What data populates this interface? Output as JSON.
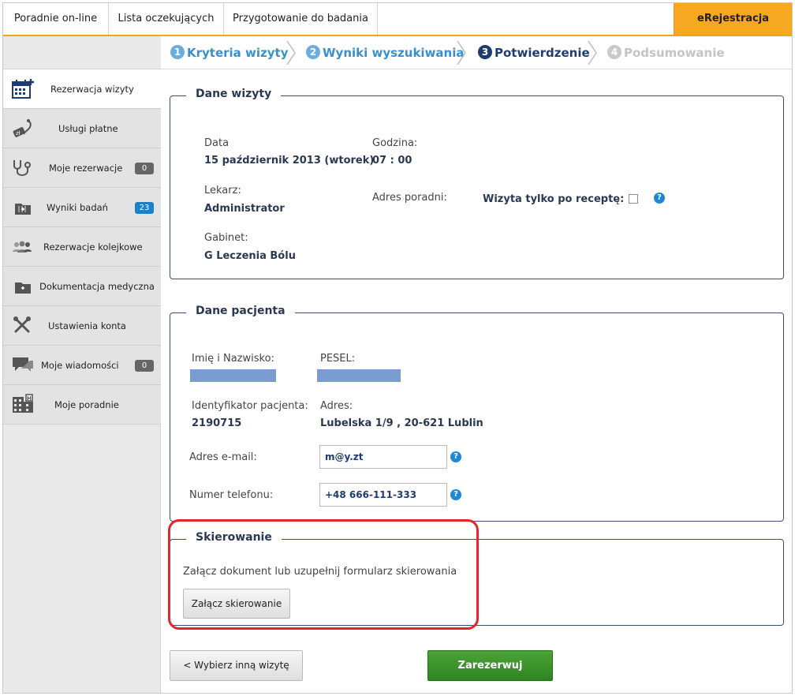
{
  "top_tabs": [
    "Poradnie on-line",
    "Lista oczekujących",
    "Przygotowanie do badania"
  ],
  "top_tab_active": "eRejestracja",
  "steps": [
    {
      "num": "1",
      "label": "Kryteria wizyty"
    },
    {
      "num": "2",
      "label": "Wyniki wyszukiwania"
    },
    {
      "num": "3",
      "label": "Potwierdzenie"
    },
    {
      "num": "4",
      "label": "Podsumowanie"
    }
  ],
  "sidebar": [
    {
      "label": "Rezerwacja wizyty",
      "icon": "calendar-icon",
      "badge": ""
    },
    {
      "label": "Usługi płatne",
      "icon": "paid-services-icon",
      "badge": ""
    },
    {
      "label": "Moje rezerwacje",
      "icon": "stethoscope-icon",
      "badge": "0"
    },
    {
      "label": "Wyniki badań",
      "icon": "folder-icon",
      "badge": "23"
    },
    {
      "label": "Rezerwacje kolejkowe",
      "icon": "people-icon",
      "badge": ""
    },
    {
      "label": "Dokumentacja medyczna",
      "icon": "folder-icon",
      "badge": ""
    },
    {
      "label": "Ustawienia konta",
      "icon": "tools-icon",
      "badge": ""
    },
    {
      "label": "Moje wiadomości",
      "icon": "chat-icon",
      "badge": "0"
    },
    {
      "label": "Moje poradnie",
      "icon": "building-icon",
      "badge": ""
    }
  ],
  "visit": {
    "legend": "Dane wizyty",
    "date_label": "Data",
    "date_value": "15 październik 2013 (wtorek)",
    "time_label": "Godzina:",
    "time_value": "07 : 00",
    "doctor_label": "Lekarz:",
    "doctor_value": "Administrator",
    "clinic_address_label": "Adres poradni:",
    "prescription_label": "Wizyta tylko po receptę:",
    "room_label": "Gabinet:",
    "room_value": "G Leczenia Bólu"
  },
  "patient": {
    "legend": "Dane pacjenta",
    "name_label": "Imię i Nazwisko:",
    "pesel_label": "PESEL:",
    "id_label": "Identyfikator pacjenta:",
    "id_value": "2190715",
    "address_label": "Adres:",
    "address_value": "Lubelska 1/9 , 20-621 Lublin",
    "email_label": "Adres e-mail:",
    "email_value": "m@y.zt",
    "phone_label": "Numer telefonu:",
    "phone_value": "+48 666-111-333"
  },
  "referral": {
    "legend": "Skierowanie",
    "text": "Załącz dokument lub uzupełnij formularz skierowania",
    "button": "Załącz skierowanie"
  },
  "actions": {
    "back": "< Wybierz inną wizytę",
    "reserve": "Zarezerwuj"
  },
  "colors": {
    "accent": "#f6a821",
    "navy": "#1f3c70",
    "link_blue": "#3a8fcf",
    "green": "#3a9a2b",
    "highlight_red": "#e0262e"
  }
}
